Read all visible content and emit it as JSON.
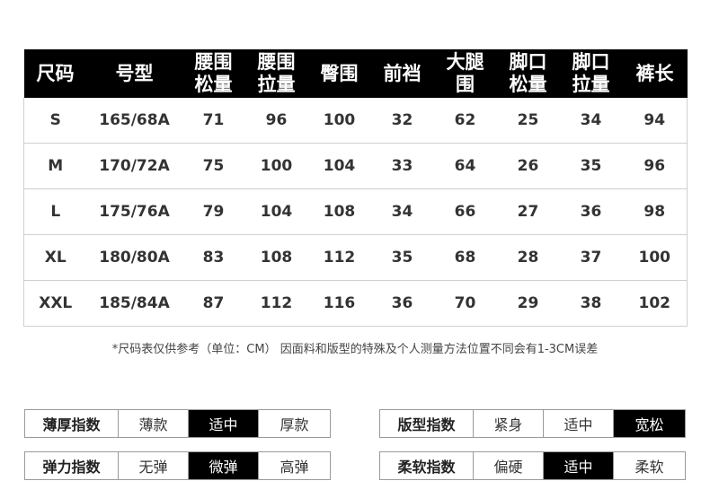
{
  "size_table": {
    "headers": [
      [
        "尺码"
      ],
      [
        "号型"
      ],
      [
        "腰围",
        "松量"
      ],
      [
        "腰围",
        "拉量"
      ],
      [
        "臀围"
      ],
      [
        "前裆"
      ],
      [
        "大腿",
        "围"
      ],
      [
        "脚口",
        "松量"
      ],
      [
        "脚口",
        "拉量"
      ],
      [
        "裤长"
      ]
    ],
    "rows": [
      [
        "S",
        "165/68A",
        "71",
        "96",
        "100",
        "32",
        "62",
        "25",
        "34",
        "94"
      ],
      [
        "M",
        "170/72A",
        "75",
        "100",
        "104",
        "33",
        "64",
        "26",
        "35",
        "96"
      ],
      [
        "L",
        "175/76A",
        "79",
        "104",
        "108",
        "34",
        "66",
        "27",
        "36",
        "98"
      ],
      [
        "XL",
        "180/80A",
        "83",
        "108",
        "112",
        "35",
        "68",
        "28",
        "37",
        "100"
      ],
      [
        "XXL",
        "185/84A",
        "87",
        "112",
        "116",
        "36",
        "70",
        "29",
        "38",
        "102"
      ]
    ]
  },
  "note": "*尺码表仅供参考（单位：CM） 因面料和版型的特殊及个人测量方法位置不同会有1-3CM误差",
  "indices": {
    "thickness": {
      "label": "薄厚指数",
      "options": [
        "薄款",
        "适中",
        "厚款"
      ],
      "selected": "适中"
    },
    "elasticity": {
      "label": "弹力指数",
      "options": [
        "无弹",
        "微弹",
        "高弹"
      ],
      "selected": "微弹"
    },
    "fit": {
      "label": "版型指数",
      "options": [
        "紧身",
        "适中",
        "宽松"
      ],
      "selected": "宽松"
    },
    "softness": {
      "label": "柔软指数",
      "options": [
        "偏硬",
        "适中",
        "柔软"
      ],
      "selected": "适中"
    }
  }
}
